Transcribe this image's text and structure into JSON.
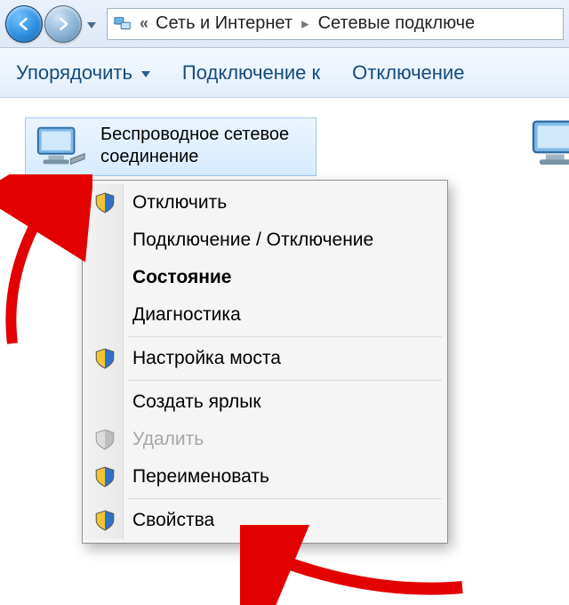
{
  "breadcrumb": {
    "seg1": "Сеть и Интернет",
    "seg2": "Сетевые подключе"
  },
  "toolbar": {
    "organize": "Упорядочить",
    "connect_to": "Подключение к",
    "disconnect": "Отключение"
  },
  "connection": {
    "line1": "Беспроводное сетевое",
    "line2": "соединение"
  },
  "context_menu": {
    "items": [
      {
        "label": "Отключить",
        "shield": true,
        "bold": false,
        "disabled": false
      },
      {
        "label": "Подключение / Отключение",
        "shield": false,
        "bold": false,
        "disabled": false
      },
      {
        "label": "Состояние",
        "shield": false,
        "bold": true,
        "disabled": false
      },
      {
        "label": "Диагностика",
        "shield": false,
        "bold": false,
        "disabled": false
      },
      {
        "sep": true
      },
      {
        "label": "Настройка моста",
        "shield": true,
        "bold": false,
        "disabled": false
      },
      {
        "sep": true
      },
      {
        "label": "Создать ярлык",
        "shield": false,
        "bold": false,
        "disabled": false
      },
      {
        "label": "Удалить",
        "shield": true,
        "bold": false,
        "disabled": true
      },
      {
        "label": "Переименовать",
        "shield": true,
        "bold": false,
        "disabled": false
      },
      {
        "sep": true
      },
      {
        "label": "Свойства",
        "shield": true,
        "bold": false,
        "disabled": false
      }
    ]
  }
}
